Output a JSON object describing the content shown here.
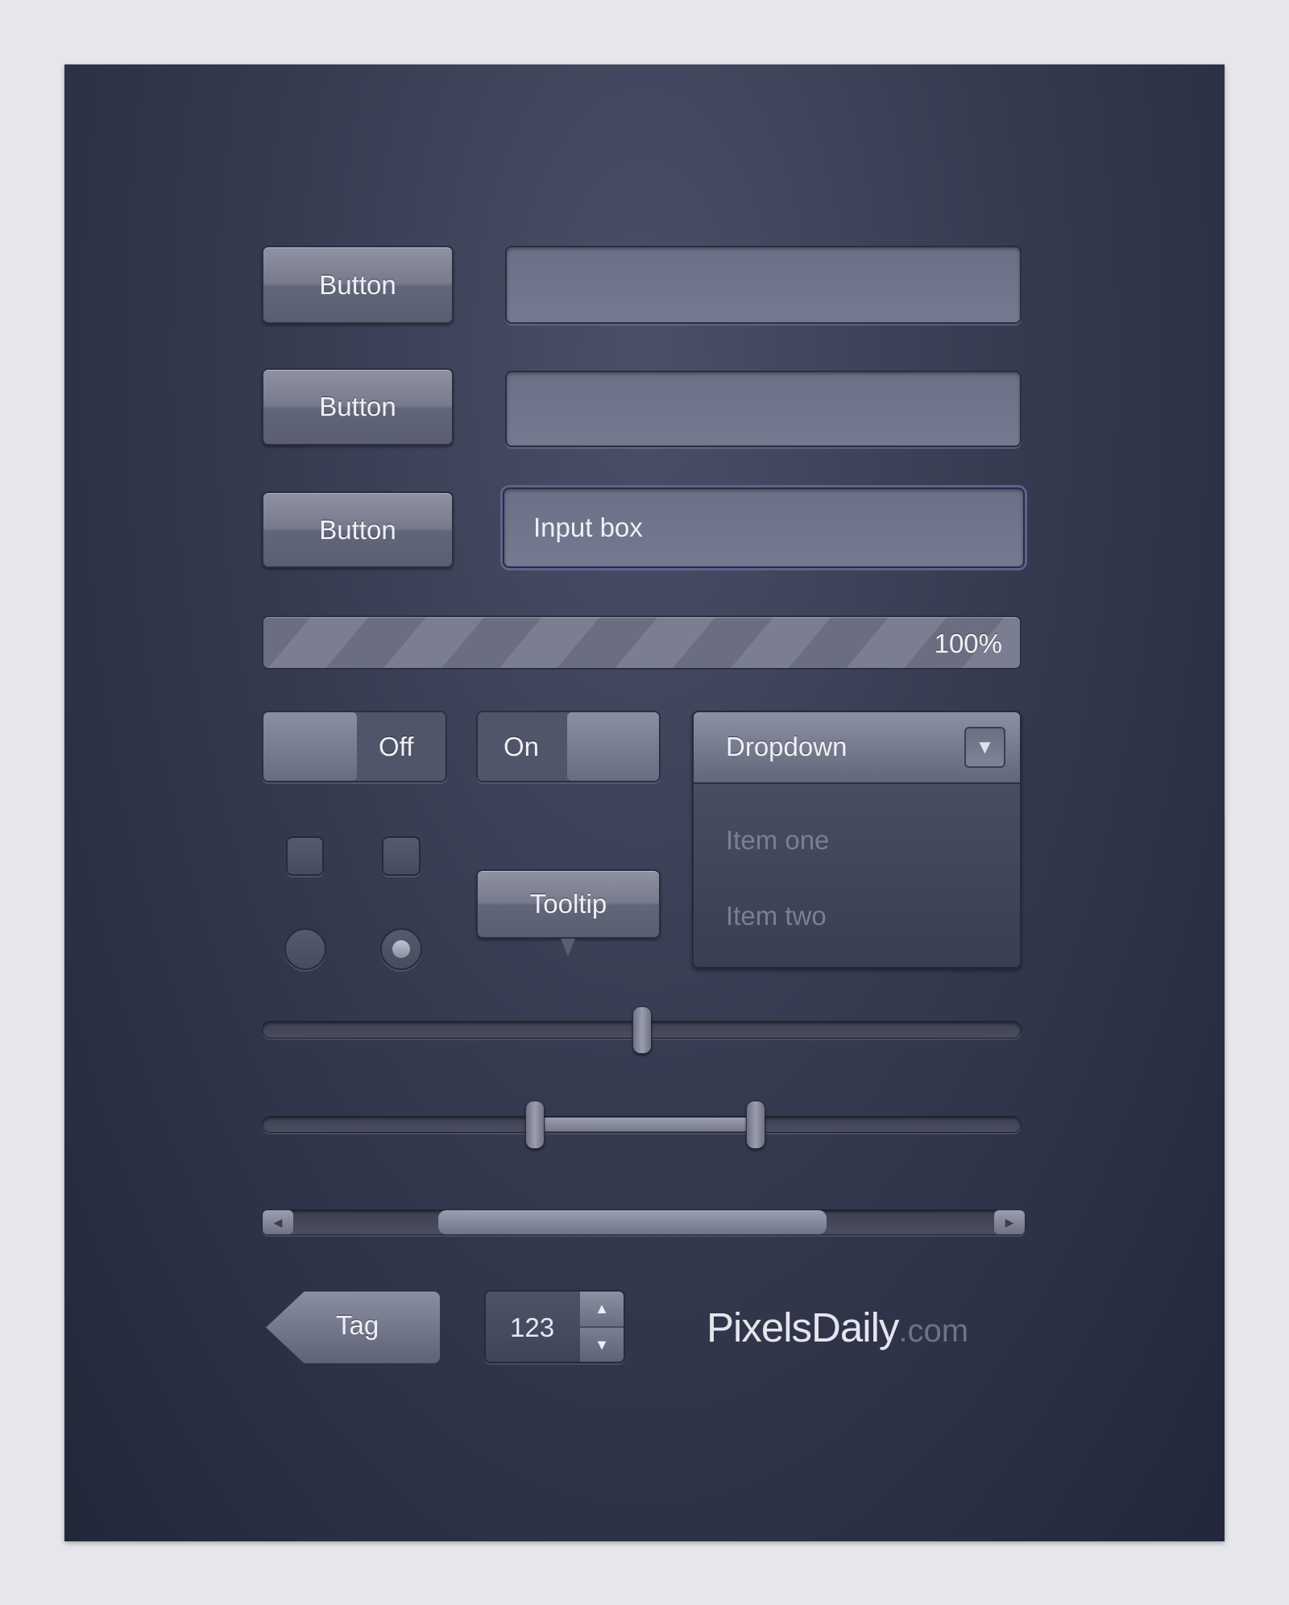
{
  "buttons": [
    {
      "label": "Button"
    },
    {
      "label": "Button"
    },
    {
      "label": "Button"
    }
  ],
  "inputs": [
    {
      "value": ""
    },
    {
      "value": ""
    },
    {
      "value": "Input box"
    }
  ],
  "progress": {
    "value_percent": 100,
    "label": "100%"
  },
  "toggle_off": {
    "label": "Off",
    "state": "off"
  },
  "toggle_on": {
    "label": "On",
    "state": "on"
  },
  "dropdown": {
    "selected": "Dropdown",
    "items": [
      "Item one",
      "Item two"
    ],
    "icon": "triangle-down-icon"
  },
  "checkboxes": [
    {
      "checked": false
    },
    {
      "checked": false
    }
  ],
  "radios": [
    {
      "selected": false
    },
    {
      "selected": true
    }
  ],
  "tooltip": {
    "label": "Tooltip"
  },
  "slider": {
    "value_percent": 50
  },
  "range_slider": {
    "low_percent": 36,
    "high_percent": 65
  },
  "scrollbar": {
    "thumb_start_percent": 23,
    "thumb_end_percent": 74
  },
  "tag": {
    "label": "Tag"
  },
  "number_stepper": {
    "value": "123",
    "up_icon": "triangle-up-icon",
    "down_icon": "triangle-down-icon"
  },
  "brand": {
    "name": "PixelsDaily",
    "suffix": ".com"
  },
  "colors": {
    "background": "#363b50",
    "control": "#767a8b",
    "text": "#f0f1f5"
  }
}
